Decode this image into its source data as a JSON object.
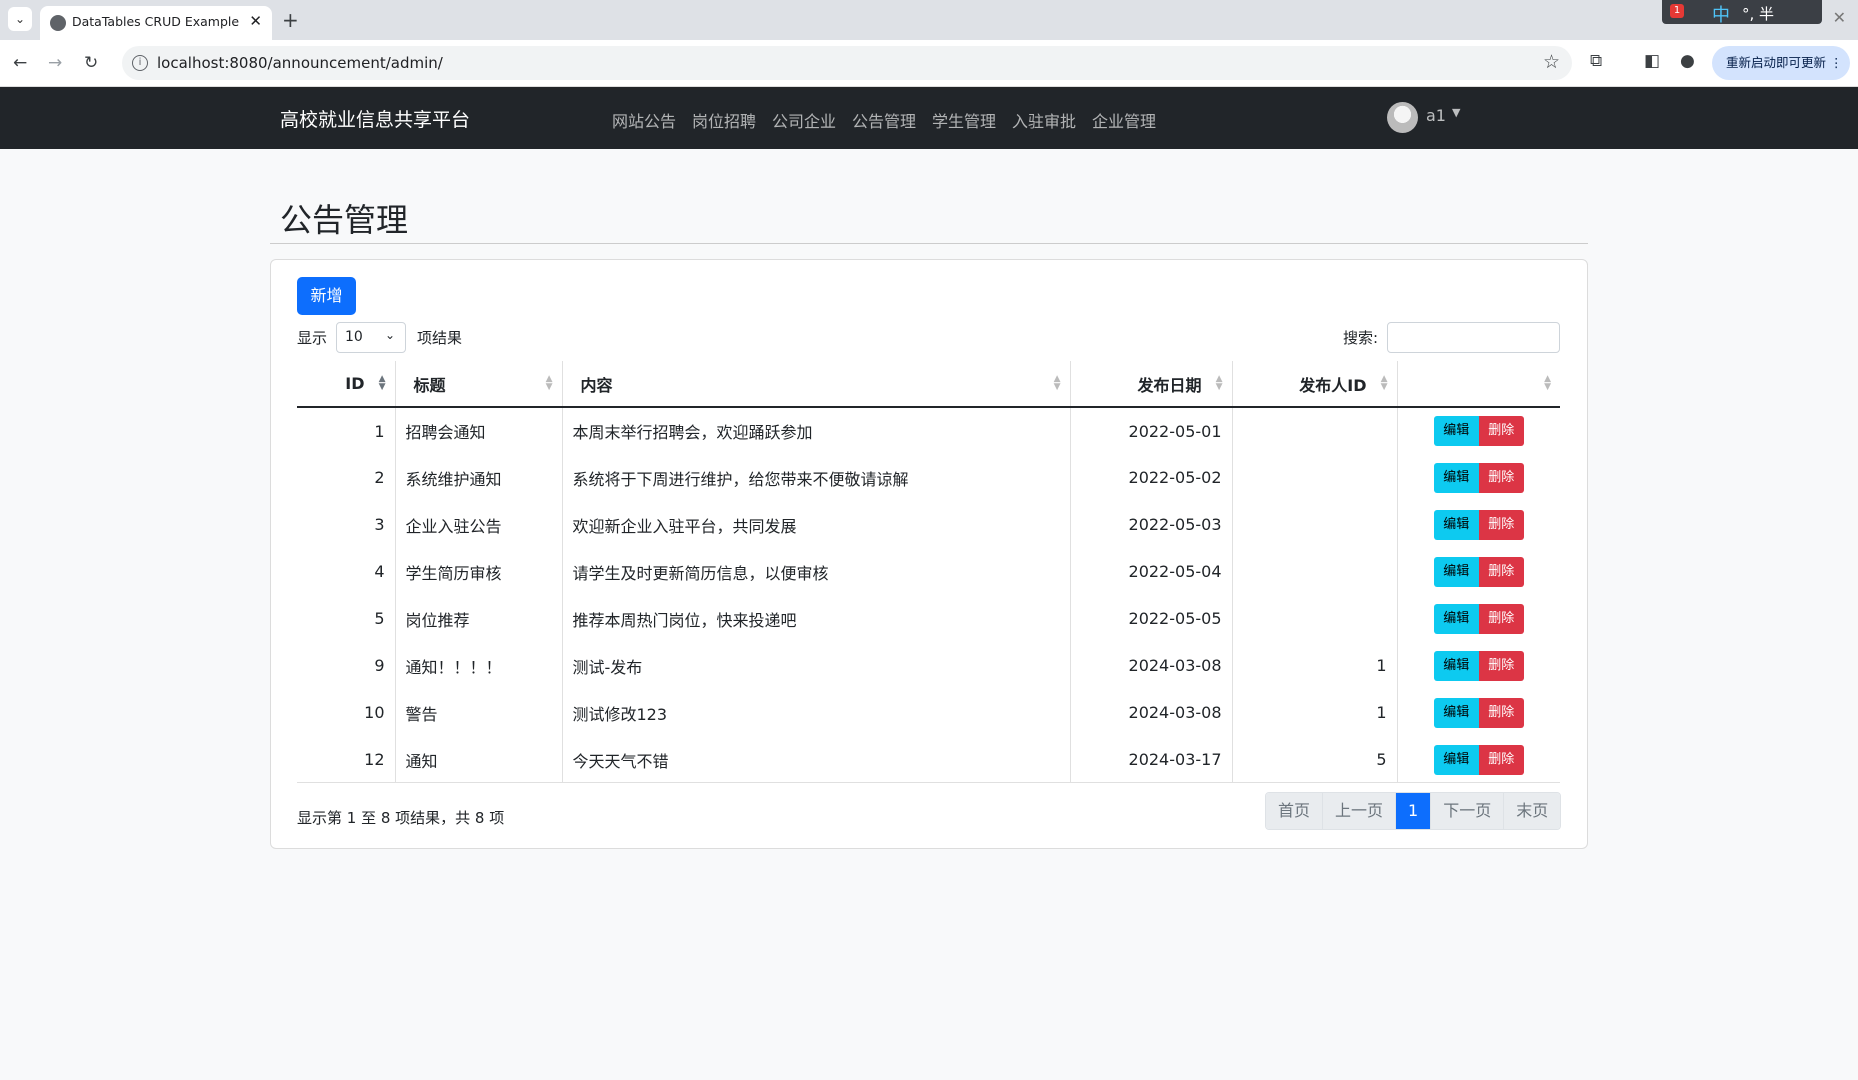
{
  "browser": {
    "tab_title": "DataTables CRUD Example w",
    "url": "localhost:8080/announcement/admin/",
    "update_button": "重新启动即可更新",
    "tray_badge": "1",
    "tray_ime": "中",
    "tray_text": "°, 半"
  },
  "navbar": {
    "brand": "高校就业信息共享平台",
    "links": [
      "网站公告",
      "岗位招聘",
      "公司企业",
      "公告管理",
      "学生管理",
      "入驻审批",
      "企业管理"
    ],
    "user": "a1"
  },
  "page": {
    "title": "公告管理",
    "add_button": "新增",
    "length_prefix": "显示",
    "length_value": "10",
    "length_suffix": "项结果",
    "search_label": "搜索:",
    "search_value": ""
  },
  "table": {
    "columns": [
      "ID",
      "标题",
      "内容",
      "发布日期",
      "发布人ID",
      ""
    ],
    "edit_label": "编辑",
    "delete_label": "删除",
    "rows": [
      {
        "id": "1",
        "title": "招聘会通知",
        "content": "本周末举行招聘会，欢迎踊跃参加",
        "date": "2022-05-01",
        "publisher": ""
      },
      {
        "id": "2",
        "title": "系统维护通知",
        "content": "系统将于下周进行维护，给您带来不便敬请谅解",
        "date": "2022-05-02",
        "publisher": ""
      },
      {
        "id": "3",
        "title": "企业入驻公告",
        "content": "欢迎新企业入驻平台，共同发展",
        "date": "2022-05-03",
        "publisher": ""
      },
      {
        "id": "4",
        "title": "学生简历审核",
        "content": "请学生及时更新简历信息，以便审核",
        "date": "2022-05-04",
        "publisher": ""
      },
      {
        "id": "5",
        "title": "岗位推荐",
        "content": "推荐本周热门岗位，快来投递吧",
        "date": "2022-05-05",
        "publisher": ""
      },
      {
        "id": "9",
        "title": "通知！！！！",
        "content": "测试-发布",
        "date": "2024-03-08",
        "publisher": "1"
      },
      {
        "id": "10",
        "title": "警告",
        "content": "测试修改123",
        "date": "2024-03-08",
        "publisher": "1"
      },
      {
        "id": "12",
        "title": "通知",
        "content": "今天天气不错",
        "date": "2024-03-17",
        "publisher": "5"
      }
    ]
  },
  "footer": {
    "info": "显示第 1 至 8 项结果，共 8 项",
    "pager": [
      "首页",
      "上一页",
      "1",
      "下一页",
      "末页"
    ]
  },
  "colors": {
    "primary": "#0d6efd",
    "info": "#0dcaf0",
    "danger": "#dc3545",
    "navbar": "#212529"
  }
}
